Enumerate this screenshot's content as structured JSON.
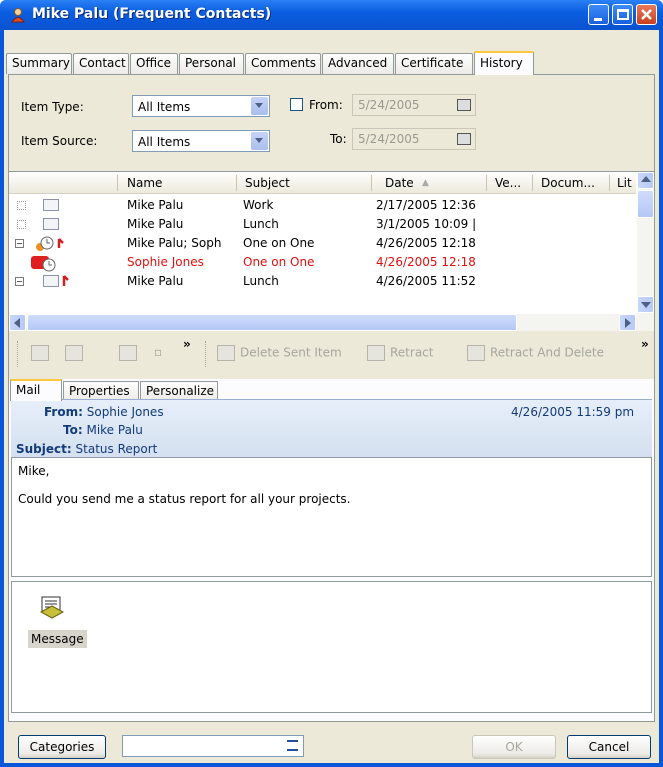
{
  "window": {
    "title": "Mike Palu (Frequent Contacts)",
    "icon": "contact-card-icon"
  },
  "tabs": [
    {
      "label": "Summary"
    },
    {
      "label": "Contact"
    },
    {
      "label": "Office"
    },
    {
      "label": "Personal"
    },
    {
      "label": "Comments"
    },
    {
      "label": "Advanced"
    },
    {
      "label": "Certificate"
    },
    {
      "label": "History",
      "active": true
    }
  ],
  "filters": {
    "item_type_label": "Item Type:",
    "item_type_value": "All Items",
    "item_source_label": "Item Source:",
    "item_source_value": "All Items",
    "from_label": "From:",
    "from_value": "5/24/2005",
    "from_checked": false,
    "to_label": "To:",
    "to_value": "5/24/2005"
  },
  "list": {
    "columns": [
      "Name",
      "Subject",
      "Date",
      "Ve...",
      "Docum...",
      "Lit"
    ],
    "rows": [
      {
        "name": "Mike Palu",
        "subject": "Work",
        "date": "2/17/2005 12:36",
        "red": false
      },
      {
        "name": "Mike Palu",
        "subject": "Lunch",
        "date": "3/1/2005 10:09 |",
        "red": false
      },
      {
        "name": "Mike Palu;  Soph",
        "subject": "One on One",
        "date": "4/26/2005 12:18",
        "red": false
      },
      {
        "name": "Sophie Jones",
        "subject": "One on One",
        "date": "4/26/2005 12:18",
        "red": true
      },
      {
        "name": "Mike Palu",
        "subject": "Lunch",
        "date": "4/26/2005 11:52",
        "red": false
      }
    ]
  },
  "toolbar": {
    "delete_sent_label": "Delete Sent Item",
    "retract_label": "Retract",
    "retract_delete_label": "Retract And Delete",
    "chevron": "»"
  },
  "inner_tabs": [
    {
      "label": "Mail",
      "active": true
    },
    {
      "label": "Properties"
    },
    {
      "label": "Personalize"
    }
  ],
  "mail": {
    "from_label": "From:",
    "from": "Sophie Jones",
    "to_label": "To:",
    "to": "Mike Palu",
    "subject_label": "Subject:",
    "subject": "Status Report",
    "date": "4/26/2005 11:59 pm",
    "body_line1": "Mike,",
    "body_line2": "Could you send me a status report for all your projects."
  },
  "attachment": {
    "label": "Message"
  },
  "footer": {
    "categories_label": "Categories",
    "ok_label": "OK",
    "cancel_label": "Cancel"
  }
}
